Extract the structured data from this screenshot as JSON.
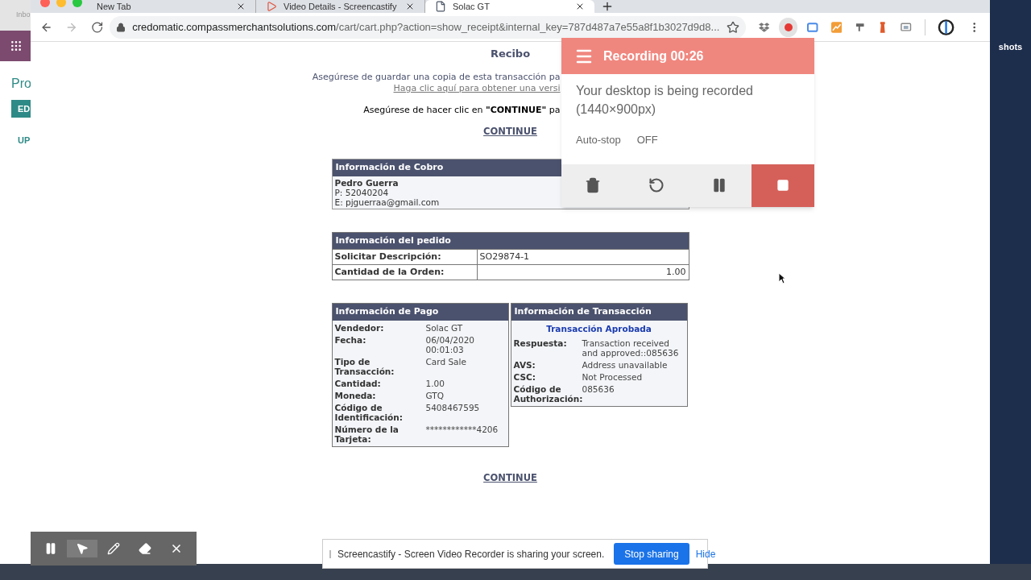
{
  "background_app": {
    "tab_label": "Inbo",
    "title": "Pro",
    "button": "ED",
    "link": "UP"
  },
  "desktop": {
    "icon_label": "shots"
  },
  "browser": {
    "tabs": [
      {
        "title": "New Tab",
        "selected": false,
        "kind": "blank"
      },
      {
        "title": "Video Details - Screencastify",
        "selected": false,
        "kind": "screencastify"
      },
      {
        "title": "Solac GT",
        "selected": true,
        "kind": "page"
      }
    ],
    "url_host": "credomatic.compassmerchantsolutions.com",
    "url_path": "/cart/cart.php?action=show_receipt&internal_key=787d487a7e55a8f1b3027d9d8..."
  },
  "receipt": {
    "title": "Recibo",
    "notice_lines": [
      "Asegúrese de guardar una copia de esta transacción pa",
      "Haga clic aquí para obtener una versi"
    ],
    "continue_notice": "Asegúrese de hacer clic en **\"CONTINUE\"** pa",
    "continue_links": [
      "CONTINUE",
      "CONTINUE"
    ],
    "billing": {
      "header": "Información de Cobro",
      "name": "Pedro Guerra",
      "phone": "P: 52040204",
      "email": "E: pjguerraa@gmail.com"
    },
    "order": {
      "header": "Información del pedido",
      "rows": [
        {
          "label": "Solicitar Descripción:",
          "value": "SO29874-1",
          "kind": "text"
        },
        {
          "label": "Cantidad de la Orden:",
          "value": "1.00",
          "kind": "number"
        }
      ]
    },
    "payment": {
      "header": "Información de Pago",
      "rows": [
        {
          "label": "Vendedor:",
          "value": "Solac GT"
        },
        {
          "label": "Fecha:",
          "value": "06/04/2020 00:01:03"
        },
        {
          "label": "Tipo de Transacción:",
          "value": "Card Sale"
        },
        {
          "label": "Cantidad:",
          "value": "1.00"
        },
        {
          "label": "Moneda:",
          "value": "GTQ"
        },
        {
          "label": "Código de Identificación:",
          "value": "5408467595"
        },
        {
          "label": "Número de la Tarjeta:",
          "value": "************4206"
        }
      ]
    },
    "transaction": {
      "header": "Información de Transacción",
      "status": "Transacción Aprobada",
      "rows": [
        {
          "label": "Respuesta:",
          "value": "Transaction received and approved::085636"
        },
        {
          "label": "AVS:",
          "value": "Address unavailable"
        },
        {
          "label": "CSC:",
          "value": "Not Processed"
        },
        {
          "label": "Código de Authorización:",
          "value": "085636"
        }
      ]
    }
  },
  "recorder_popup": {
    "title": "Recording 00:26",
    "message": "Your desktop is being recorded (1440×900px)",
    "autostop_label": "Auto-stop",
    "autostop_value": "OFF",
    "actions": [
      {
        "kind": "delete"
      },
      {
        "kind": "restart"
      },
      {
        "kind": "pause"
      },
      {
        "kind": "stop"
      }
    ]
  },
  "annotation_toolbar": {
    "tools": [
      {
        "kind": "pause",
        "selected": false
      },
      {
        "kind": "pointer",
        "selected": true
      },
      {
        "kind": "pen",
        "selected": false
      },
      {
        "kind": "eraser",
        "selected": false
      },
      {
        "kind": "close",
        "selected": false
      }
    ]
  },
  "share_bar": {
    "message": "Screencastify - Screen Video Recorder is sharing your screen.",
    "stop_button": "Stop sharing",
    "hide_link": "Hide"
  }
}
